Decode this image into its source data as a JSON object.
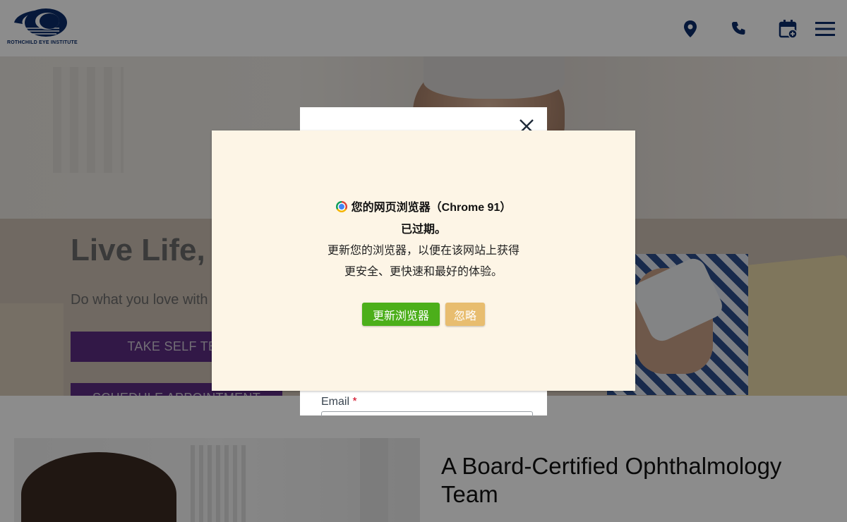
{
  "header": {
    "logo_text": "ROTHCHILD EYE INSTITUTE",
    "icons": [
      "location-pin-icon",
      "phone-icon",
      "calendar-add-icon",
      "hamburger-menu-icon"
    ],
    "brand_color": "#0b2d6b"
  },
  "hero": {
    "title": "Live Life, U",
    "subtitle": "Do what you love with",
    "buttons": [
      "TAKE SELF TES",
      "SCHEDULE APPOINTMENT"
    ],
    "button_color": "#7a1fd6"
  },
  "section": {
    "title": "A Board-Certified Ophthalmology Team"
  },
  "modal": {
    "email_label": "Email",
    "required_mark": "*"
  },
  "browser_notice": {
    "line1": "您的网页浏览器",
    "version": "（Chrome 91）",
    "line2": "已过期。",
    "body": "更新您的浏览器，以便在该网站上获得更安全、更快速和最好的体验。",
    "update_button": "更新浏览器",
    "ignore_button": "忽略",
    "update_color": "#4caf1a",
    "ignore_color": "#e8bd6f",
    "background": "#fdf5e6"
  }
}
